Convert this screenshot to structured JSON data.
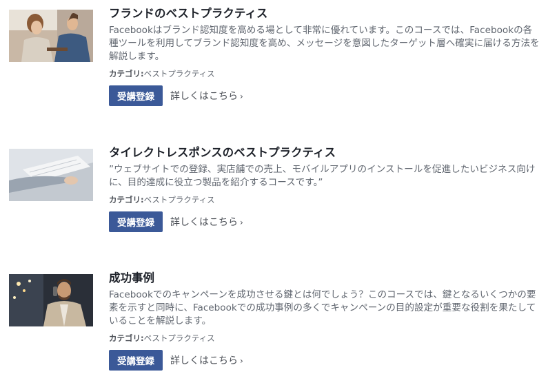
{
  "courses": [
    {
      "title": "フランドのベストプラクティス",
      "description": "Facebookはブランド認知度を高める場として非常に優れています。このコースでは、Facebookの各種ツールを利用してブランド認知度を高め、メッセージを意図したターゲット層へ確実に届ける方法を解説します。",
      "category_label": "カテゴリ:",
      "category_value": "ベストプラクティス",
      "enroll_label": "受講登録",
      "more_label": "詳しくはこちら",
      "more_icon": "›"
    },
    {
      "title": "タイレクトレスポンスのベストプラクティス",
      "description": "”ウェブサイトでの登録、実店舗での売上、モバイルアプリのインストールを促進したいビジネス向けに、目的達成に役立つ製品を紹介するコースです。”",
      "category_label": "カテゴリ:",
      "category_value": "ベストプラクティス",
      "enroll_label": "受講登録",
      "more_label": "詳しくはこちら",
      "more_icon": "›"
    },
    {
      "title": "成功事例",
      "description": "Facebookでのキャンペーンを成功させる鍵とは何でしょう？このコースでは、鍵となるいくつかの要素を示すと同時に、Facebookでの成功事例の多くでキャンペーンの目的設定が重要な役割を果たしていることを解説します。",
      "category_label": "カテゴリ:",
      "category_value": "ベストプラクティス",
      "enroll_label": "受講登録",
      "more_label": "詳しくはこちら",
      "more_icon": "›"
    }
  ],
  "colors": {
    "enroll_button": "#3b5998"
  }
}
